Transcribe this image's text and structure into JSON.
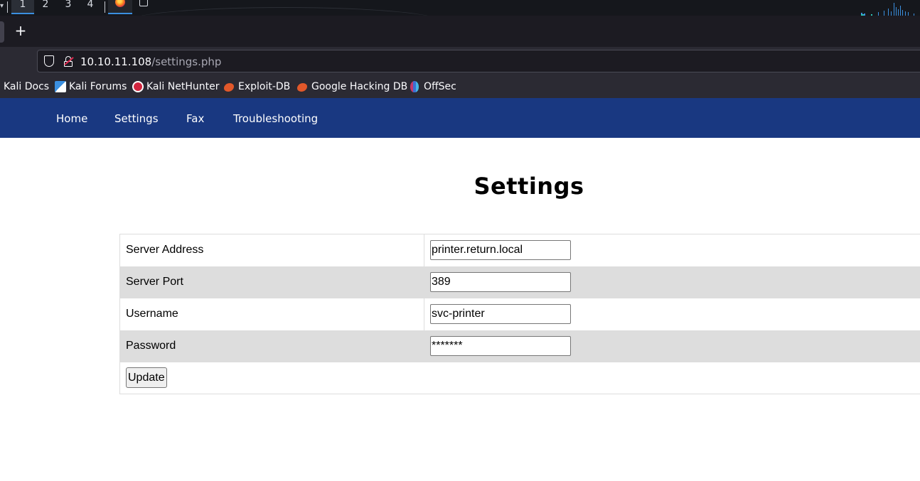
{
  "panel": {
    "workspaces": [
      "1",
      "2",
      "3",
      "4"
    ],
    "active_workspace": "1"
  },
  "tabstrip": {
    "new_tab_label": "+"
  },
  "navbar": {
    "url_host": "10.10.11.108",
    "url_path": "/settings.php"
  },
  "bookmarks": [
    {
      "label": "Kali Docs",
      "icon": "none"
    },
    {
      "label": "Kali Forums",
      "icon": "kali-forums-icon"
    },
    {
      "label": "Kali NetHunter",
      "icon": "nethunter-icon"
    },
    {
      "label": "Exploit-DB",
      "icon": "exploit-db-icon"
    },
    {
      "label": "Google Hacking DB",
      "icon": "exploit-db-icon"
    },
    {
      "label": "OffSec",
      "icon": "offsec-icon"
    }
  ],
  "site": {
    "nav": [
      "Home",
      "Settings",
      "Fax",
      "Troubleshooting"
    ],
    "title": "Settings",
    "fields": [
      {
        "label": "Server Address",
        "value": "printer.return.local"
      },
      {
        "label": "Server Port",
        "value": "389"
      },
      {
        "label": "Username",
        "value": "svc-printer"
      },
      {
        "label": "Password",
        "value": "*******"
      }
    ],
    "update_label": "Update"
  },
  "colors": {
    "site_nav_bg": "#193881",
    "row_shade": "#dddddd",
    "browser_toolbar": "#2b2a33",
    "panel_bg": "#15171c"
  }
}
